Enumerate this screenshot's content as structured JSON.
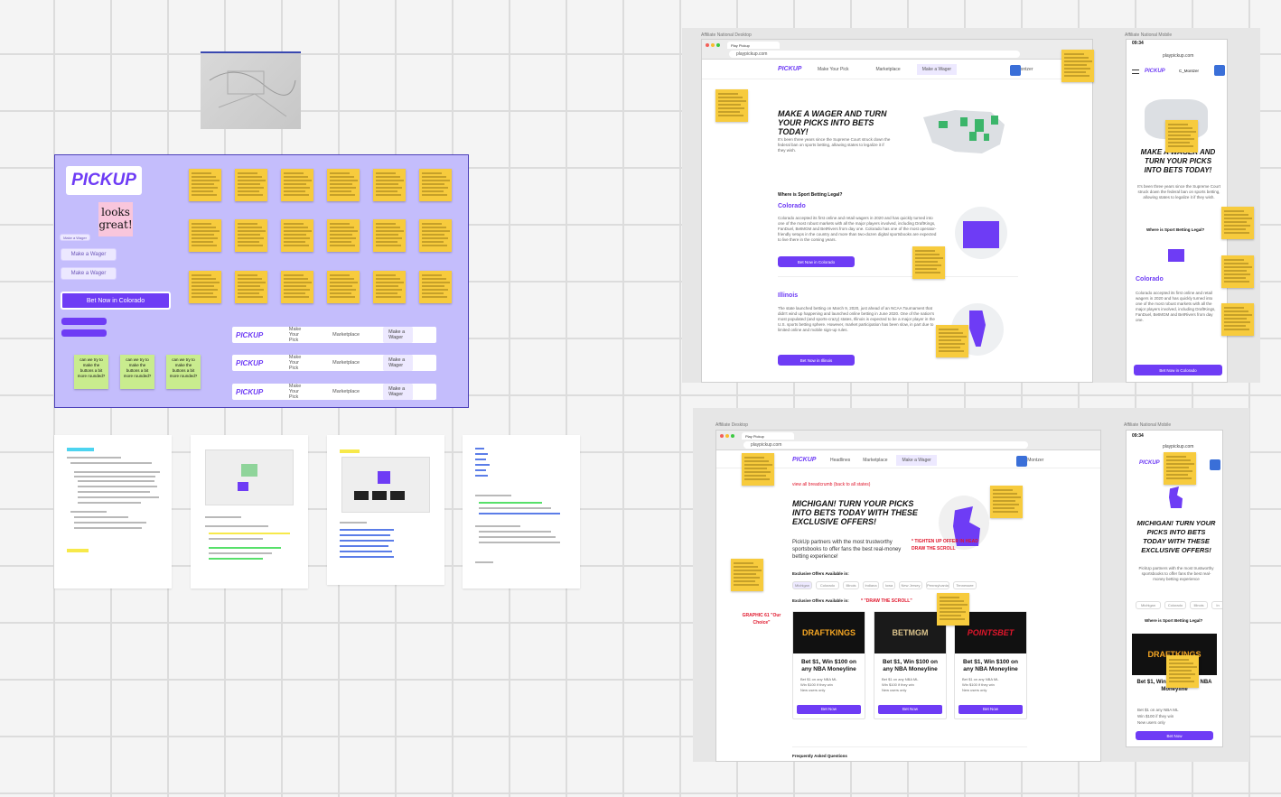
{
  "board": {
    "pickup_logo": "PICKUP",
    "looks_great": "looks great!",
    "make_wager_small": "Make a Wager",
    "make_wager": "Make a Wager",
    "bet_now_colorado": "Bet Now in Colorado",
    "green_note": "can we try to make the buttons a bit more rounded?",
    "navbars": [
      {
        "logo": "PICKUP",
        "items": [
          "Make Your Pick",
          "Marketplace",
          "Make a Wager"
        ]
      },
      {
        "logo": "PICKUP",
        "items": [
          "Make Your Pick",
          "Marketplace",
          "Make a Wager"
        ]
      },
      {
        "logo": "PICKUP",
        "items": [
          "Make Your Pick",
          "Marketplace",
          "Make a Wager"
        ]
      }
    ]
  },
  "frames": {
    "affiliate_national_desktop": "Affiliate National Desktop",
    "affiliate_national_mobile": "Affiliate National Mobile",
    "affiliate_desktop": "Affiliate Desktop",
    "affiliate_national_mobile_2": "Affiliate National Mobile"
  },
  "desktop1": {
    "url": "playpickup.com",
    "tab": "Play Pickup",
    "logo": "PICKUP",
    "nav": [
      "Make Your Pick",
      "Marketplace",
      "Make a Wager"
    ],
    "user": "C_Montzer",
    "headline": "MAKE A WAGER AND TURN YOUR PICKS INTO BETS TODAY!",
    "intro": "It's been three years since the Supreme Court struck down the federal ban on sports betting, allowing states to legalize it if they wish.",
    "where_legal": "Where is Sport Betting Legal?",
    "colorado_heading": "Colorado",
    "colorado_text": "Colorado accepted its first online and retail wagers in 2020 and has quickly turned into one of the most robust markets with all the major players involved, including DraftKings, FanDuel, BetMGM and BetRivers from day one. Colorado has one of the most operator-friendly setups in the country and more than two-dozen digital sportsbooks are expected to live there in the coming years.",
    "colorado_btn": "Bet Now in Colorado",
    "illinois_heading": "Illinois",
    "illinois_text": "The state launched betting on March 9, 2020, just ahead of an NCAA Tournament that didn't wind up happening and launched online betting in June 2020. One of the nation's most populated (and sports-crazy) states, Illinois is expected to be a major player in the U.S. sports betting sphere. However, market participation has been slow, in part due to limited online and mobile sign-up rules.",
    "illinois_btn": "Bet Now in Illinois"
  },
  "mobile1": {
    "time": "09:34",
    "url": "playpickup.com",
    "logo": "PICKUP",
    "user": "C_Montzer",
    "headline": "MAKE A WAGER AND TURN YOUR PICKS INTO BETS TODAY!",
    "intro": "It's been three years since the Supreme Court struck down the federal ban on sports betting, allowing states to legalize it if they wish.",
    "where_legal": "Where is Sport Betting Legal?",
    "colorado_heading": "Colorado",
    "colorado_text": "Colorado accepted its first online and retail wagers in 2020 and has quickly turned into one of the most robust markets with all the major players involved, including DraftKings, FanDuel, BetMGM and BetRivers from day one.",
    "colorado_btn": "Bet Now in Colorado"
  },
  "desktop2": {
    "url": "playpickup.com",
    "tab": "Play Pickup",
    "logo": "PICKUP",
    "nav": [
      "Headlines",
      "Marketplace",
      "Make a Wager"
    ],
    "user": "C_Montzer",
    "breadcrumb": "view all breadcrumb (back to all states)",
    "headline": "MICHIGAN! TURN YOUR PICKS INTO BETS TODAY WITH THESE EXCLUSIVE OFFERS!",
    "intro": "PickUp partners with the most trustworthy sportsbooks to offer fans the best real-money betting experience!",
    "tighten": "* TIGHTEN UP OFFER IN HEAD",
    "draw_scroll": "DRAW THE SCROLL",
    "offers_label": "Exclusive Offers Available in:",
    "state_pills": [
      "Michigan",
      "Colorado",
      "Illinois",
      "Indiana",
      "Iowa",
      "New Jersey",
      "Pennsylvania",
      "Tennessee"
    ],
    "offers_label2": "Exclusive Offers Available in:",
    "draw_scroll2": "* \"DRAW THE SCROLL\"",
    "graphic": "GRAPHIC 61 \"Our Choice\"",
    "offers": [
      {
        "brand": "DRAFTKINGS",
        "title": "Bet $1, Win $100 on any NBA Moneyline",
        "bullets": [
          "Bet $1 on any NBA ML",
          "Win $100 if they win",
          "New users only"
        ],
        "btn": "Bet Now"
      },
      {
        "brand": "BETMGM",
        "title": "Bet $1, Win $100 on any NBA Moneyline",
        "bullets": [
          "Bet $1 on any NBA ML",
          "Win $100 if they win",
          "New users only"
        ],
        "btn": "Bet Now"
      },
      {
        "brand": "POINTSBET",
        "title": "Bet $1, Win $100 on any NBA Moneyline",
        "bullets": [
          "Bet $1 on any NBA ML",
          "Win $100 if they win",
          "New users only"
        ],
        "btn": "Bet Now"
      }
    ],
    "faq": "Frequently Asked Questions"
  },
  "mobile2": {
    "time": "09:34",
    "url": "playpickup.com",
    "logo": "PICKUP",
    "headline": "MICHIGAN! TURN YOUR PICKS INTO BETS TODAY WITH THESE EXCLUSIVE OFFERS!",
    "intro": "PickUp partners with the most trustworthy sportsbooks to offer fans the best real-money betting experience",
    "pills": [
      "Michigan",
      "Colorado",
      "Illinois",
      "In"
    ],
    "where_legal": "Where is Sport Betting Legal?",
    "brand": "DRAFTKINGS",
    "title": "Bet $1, Win $100 on any NBA Moneyline",
    "bullets": [
      "Bet $1 on any NBA ML",
      "Win $100 if they win",
      "New users only"
    ],
    "btn": "Bet Now"
  },
  "colors": {
    "accent": "#6e3cf5",
    "sticky": "#f7cb3d",
    "green_sticky": "#c9ec8e",
    "board": "#c4bdfc"
  }
}
